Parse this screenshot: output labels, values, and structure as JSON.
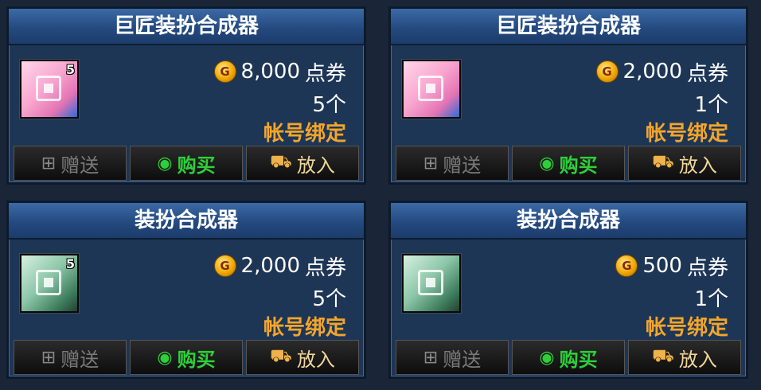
{
  "cards": [
    {
      "title": "巨匠装扮合成器",
      "icon": "pink-cube-icon",
      "icon_count": "5",
      "price": "8,000",
      "currency": "点券",
      "quantity": "5个",
      "binding": "帐号绑定",
      "buttons": {
        "gift": "赠送",
        "buy": "购买",
        "cart": "放入"
      }
    },
    {
      "title": "巨匠装扮合成器",
      "icon": "pink-cube-icon",
      "icon_count": "",
      "price": "2,000",
      "currency": "点券",
      "quantity": "1个",
      "binding": "帐号绑定",
      "buttons": {
        "gift": "赠送",
        "buy": "购买",
        "cart": "放入"
      }
    },
    {
      "title": "装扮合成器",
      "icon": "green-cube-icon",
      "icon_count": "5",
      "price": "2,000",
      "currency": "点券",
      "quantity": "5个",
      "binding": "帐号绑定",
      "buttons": {
        "gift": "赠送",
        "buy": "购买",
        "cart": "放入"
      }
    },
    {
      "title": "装扮合成器",
      "icon": "green-cube-icon",
      "icon_count": "",
      "price": "500",
      "currency": "点券",
      "quantity": "1个",
      "binding": "帐号绑定",
      "buttons": {
        "gift": "赠送",
        "buy": "购买",
        "cart": "放入"
      }
    }
  ],
  "colors": {
    "card_bg": "#1e3656",
    "title_bar": "#2c5a94",
    "binding_text": "#f3a52b",
    "buy_text": "#2ecf3a"
  }
}
